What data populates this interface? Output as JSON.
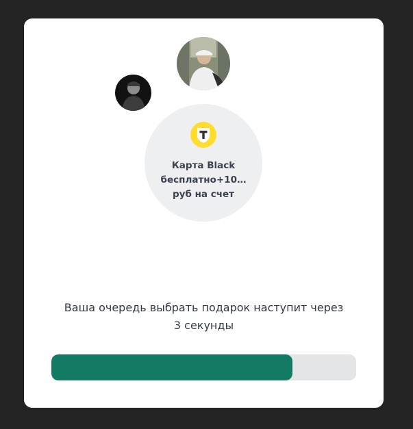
{
  "offer": {
    "logo_icon": "tinkoff-logo-icon",
    "title": "Карта Black\nбесплатно+10…\nруб на счет",
    "logo_color": "#ffdd2d"
  },
  "avatars": [
    {
      "icon": "user-avatar-photo"
    },
    {
      "icon": "user-avatar-photo"
    }
  ],
  "message": {
    "line1": "Ваша очередь выбрать подарок наступит через",
    "line2": "3 секунды"
  },
  "progress": {
    "value_percent": 79,
    "fill_color": "#137b64",
    "track_color": "#e4e5e7"
  }
}
